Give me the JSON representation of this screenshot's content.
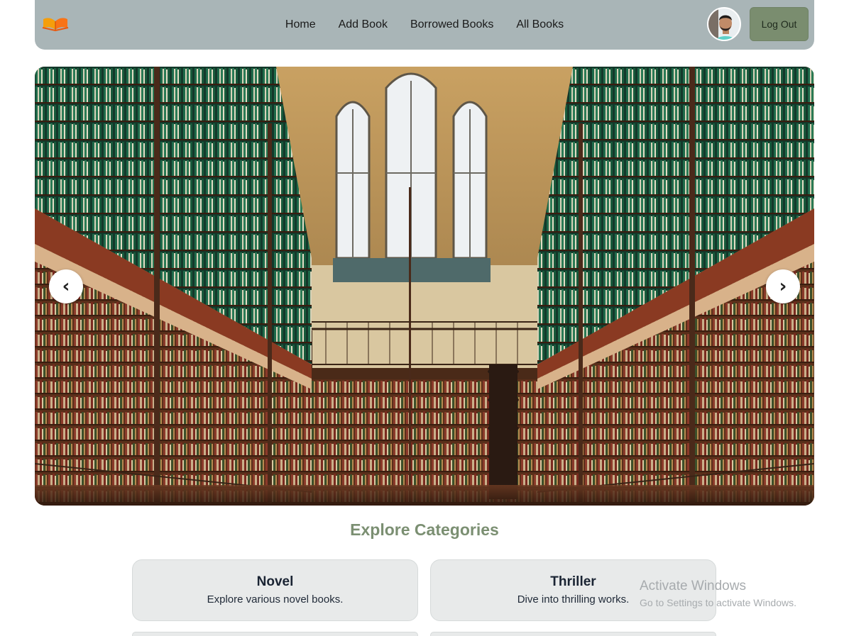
{
  "nav": {
    "links": [
      {
        "label": "Home"
      },
      {
        "label": "Add Book"
      },
      {
        "label": "Borrowed Books"
      },
      {
        "label": "All Books"
      }
    ],
    "logout_label": "Log Out"
  },
  "carousel": {
    "prev_icon": "‹",
    "next_icon": "›"
  },
  "categories": {
    "title": "Explore Categories",
    "items": [
      {
        "title": "Novel",
        "description": "Explore various novel books."
      },
      {
        "title": "Thriller",
        "description": "Dive into thrilling works."
      }
    ]
  },
  "watermark": {
    "title": "Activate Windows",
    "subtitle": "Go to Settings to activate Windows."
  },
  "colors": {
    "navbar": "#a9b5b7",
    "logout_button": "#7a8d6f",
    "section_title": "#7b8f72",
    "card_background": "#e8eaea"
  },
  "icons": {
    "logo": "open-book-icon",
    "avatar": "user-avatar"
  }
}
